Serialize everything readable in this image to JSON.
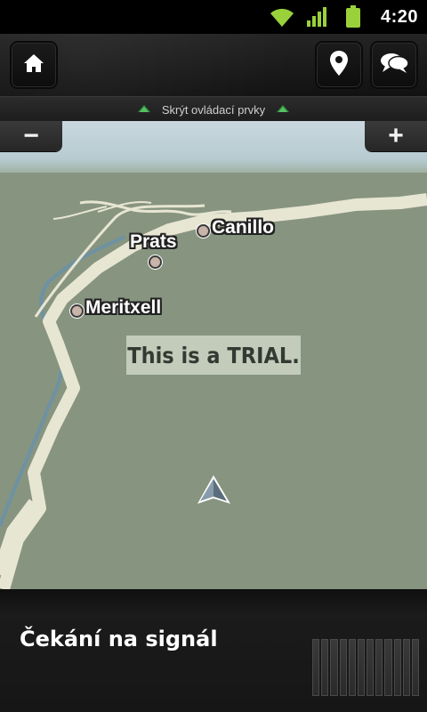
{
  "status_bar": {
    "time": "4:20",
    "icons": [
      "wifi-icon",
      "cell-signal-icon",
      "battery-icon"
    ],
    "accent_color": "#9ad13a"
  },
  "toolbar": {
    "home_icon": "home-icon",
    "location_icon": "map-pin-icon",
    "chat_icon": "chat-bubbles-icon"
  },
  "hide_controls": {
    "label": "Skrýt ovládací prvky"
  },
  "zoom": {
    "out_label": "−",
    "in_label": "+"
  },
  "map": {
    "places": [
      {
        "name": "Canillo"
      },
      {
        "name": "Prats"
      },
      {
        "name": "Meritxell"
      }
    ],
    "trial_text": "This is a TRIAL."
  },
  "bottom": {
    "signal_text": "Čekání na signál",
    "signal_bars": 12
  }
}
